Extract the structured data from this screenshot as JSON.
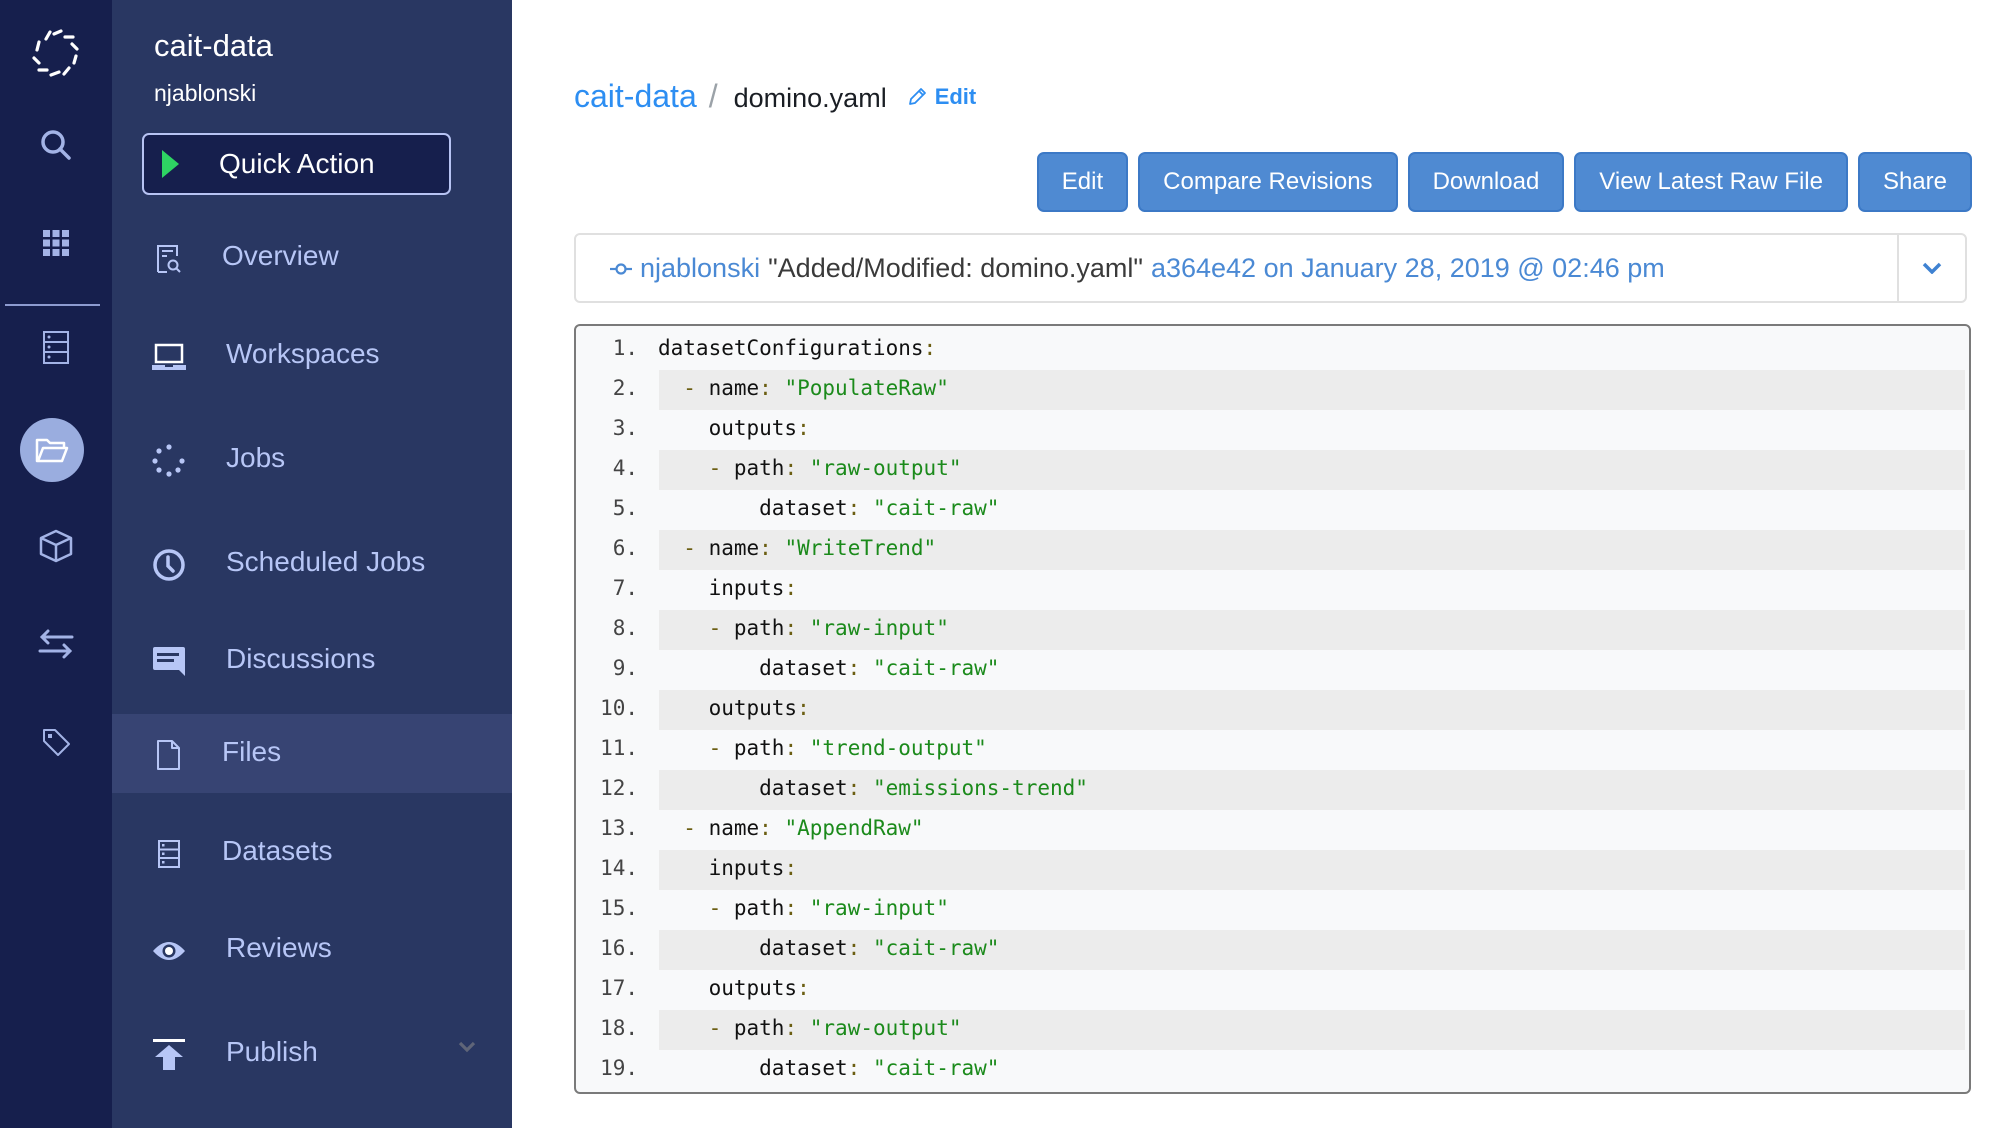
{
  "rail": {
    "items": [
      {
        "icon": "domino-logo-icon"
      },
      {
        "icon": "search-icon"
      },
      {
        "icon": "apps-grid-icon"
      },
      {
        "icon": "datasets-icon"
      },
      {
        "icon": "folder-icon",
        "active": true
      },
      {
        "icon": "cube-icon"
      },
      {
        "icon": "transfer-arrows-icon"
      },
      {
        "icon": "tag-icon"
      }
    ]
  },
  "sidebar": {
    "project_name": "cait-data",
    "owner": "njablonski",
    "quick_action_label": "Quick Action",
    "items": [
      {
        "label": "Overview",
        "icon": "overview-icon"
      },
      {
        "label": "Workspaces",
        "icon": "laptop-icon"
      },
      {
        "label": "Jobs",
        "icon": "jobs-spinner-icon"
      },
      {
        "label": "Scheduled Jobs",
        "icon": "clock-icon"
      },
      {
        "label": "Discussions",
        "icon": "chat-icon"
      },
      {
        "label": "Files",
        "icon": "file-icon",
        "active": true
      },
      {
        "label": "Datasets",
        "icon": "datasets-icon"
      },
      {
        "label": "Reviews",
        "icon": "eye-icon"
      },
      {
        "label": "Publish",
        "icon": "publish-icon",
        "has_chevron": true
      }
    ]
  },
  "breadcrumb": {
    "project": "cait-data",
    "separator": "/",
    "file": "domino.yaml",
    "edit_label": "Edit"
  },
  "toolbar": {
    "edit_label": "Edit",
    "compare_label": "Compare Revisions",
    "download_label": "Download",
    "view_raw_label": "View Latest Raw File",
    "share_label": "Share"
  },
  "commit": {
    "author": "njablonski",
    "message": "\"Added/Modified: domino.yaml\"",
    "meta": "a364e42 on January 28, 2019 @ 02:46 pm"
  },
  "colors": {
    "accent": "#2d8ef2",
    "button": "#4f8ad2",
    "rail_bg": "#161f4d",
    "sidebar_bg": "#293762",
    "string": "#1b8a1b"
  },
  "code": {
    "lines": [
      {
        "n": "1.",
        "indent": "",
        "dash": false,
        "key": "datasetConfigurations",
        "value": null
      },
      {
        "n": "2.",
        "indent": "  ",
        "dash": true,
        "key": "name",
        "value": "\"PopulateRaw\""
      },
      {
        "n": "3.",
        "indent": "    ",
        "dash": false,
        "key": "outputs",
        "value": null
      },
      {
        "n": "4.",
        "indent": "    ",
        "dash": true,
        "key": "path",
        "value": "\"raw-output\""
      },
      {
        "n": "5.",
        "indent": "        ",
        "dash": false,
        "key": "dataset",
        "value": "\"cait-raw\""
      },
      {
        "n": "6.",
        "indent": "  ",
        "dash": true,
        "key": "name",
        "value": "\"WriteTrend\""
      },
      {
        "n": "7.",
        "indent": "    ",
        "dash": false,
        "key": "inputs",
        "value": null
      },
      {
        "n": "8.",
        "indent": "    ",
        "dash": true,
        "key": "path",
        "value": "\"raw-input\""
      },
      {
        "n": "9.",
        "indent": "        ",
        "dash": false,
        "key": "dataset",
        "value": "\"cait-raw\""
      },
      {
        "n": "10.",
        "indent": "    ",
        "dash": false,
        "key": "outputs",
        "value": null
      },
      {
        "n": "11.",
        "indent": "    ",
        "dash": true,
        "key": "path",
        "value": "\"trend-output\""
      },
      {
        "n": "12.",
        "indent": "        ",
        "dash": false,
        "key": "dataset",
        "value": "\"emissions-trend\""
      },
      {
        "n": "13.",
        "indent": "  ",
        "dash": true,
        "key": "name",
        "value": "\"AppendRaw\""
      },
      {
        "n": "14.",
        "indent": "    ",
        "dash": false,
        "key": "inputs",
        "value": null
      },
      {
        "n": "15.",
        "indent": "    ",
        "dash": true,
        "key": "path",
        "value": "\"raw-input\""
      },
      {
        "n": "16.",
        "indent": "        ",
        "dash": false,
        "key": "dataset",
        "value": "\"cait-raw\""
      },
      {
        "n": "17.",
        "indent": "    ",
        "dash": false,
        "key": "outputs",
        "value": null
      },
      {
        "n": "18.",
        "indent": "    ",
        "dash": true,
        "key": "path",
        "value": "\"raw-output\""
      },
      {
        "n": "19.",
        "indent": "        ",
        "dash": false,
        "key": "dataset",
        "value": "\"cait-raw\""
      }
    ]
  }
}
